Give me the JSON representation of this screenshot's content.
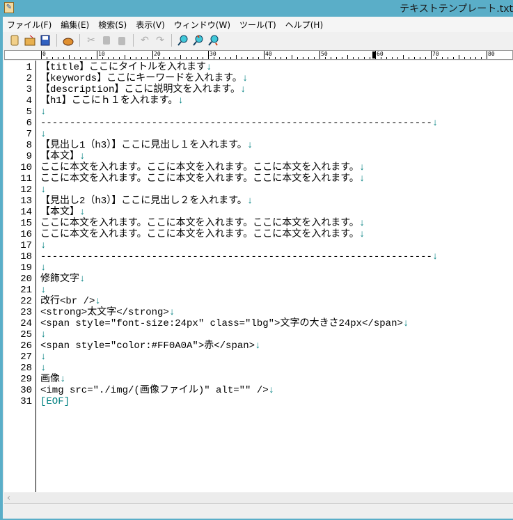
{
  "window": {
    "title": "テキストテンプレート.txt"
  },
  "menu": [
    "ファイル(F)",
    "編集(E)",
    "検索(S)",
    "表示(V)",
    "ウィンドウ(W)",
    "ツール(T)",
    "ヘルプ(H)"
  ],
  "toolbar": [
    "new-file",
    "open-folder",
    "save",
    "print",
    "cut",
    "copy",
    "paste",
    "undo",
    "redo",
    "search",
    "search-next",
    "search-prev"
  ],
  "ruler": [
    "0",
    "10",
    "20",
    "30",
    "40",
    "50",
    "60",
    "70",
    "80"
  ],
  "colors": {
    "eol": "#008080",
    "titlebar": "#5aaec8"
  },
  "lines": [
    {
      "n": "1",
      "t": "【title】ここにタイトルを入れます",
      "e": "↓"
    },
    {
      "n": "2",
      "t": "【keywords】ここにキーワードを入れます。",
      "e": "↓"
    },
    {
      "n": "3",
      "t": "【description】ここに説明文を入れます。",
      "e": "↓"
    },
    {
      "n": "4",
      "t": "【h1】ここにｈ１を入れます。",
      "e": "↓"
    },
    {
      "n": "5",
      "t": "",
      "e": "↓"
    },
    {
      "n": "6",
      "t": "-------------------------------------------------------------------",
      "e": "↓"
    },
    {
      "n": "7",
      "t": "",
      "e": "↓"
    },
    {
      "n": "8",
      "t": "【見出し1（h3）】ここに見出し１を入れます。",
      "e": "↓"
    },
    {
      "n": "9",
      "t": "【本文】",
      "e": "↓"
    },
    {
      "n": "10",
      "t": "ここに本文を入れます。ここに本文を入れます。ここに本文を入れます。",
      "e": "↓"
    },
    {
      "n": "11",
      "t": "ここに本文を入れます。ここに本文を入れます。ここに本文を入れます。",
      "e": "↓"
    },
    {
      "n": "12",
      "t": "",
      "e": "↓"
    },
    {
      "n": "13",
      "t": "【見出し2（h3）】ここに見出し２を入れます。",
      "e": "↓"
    },
    {
      "n": "14",
      "t": "【本文】",
      "e": "↓"
    },
    {
      "n": "15",
      "t": "ここに本文を入れます。ここに本文を入れます。ここに本文を入れます。",
      "e": "↓"
    },
    {
      "n": "16",
      "t": "ここに本文を入れます。ここに本文を入れます。ここに本文を入れます。",
      "e": "↓"
    },
    {
      "n": "17",
      "t": "",
      "e": "↓"
    },
    {
      "n": "18",
      "t": "-------------------------------------------------------------------",
      "e": "↓"
    },
    {
      "n": "19",
      "t": "",
      "e": "↓"
    },
    {
      "n": "20",
      "t": "修飾文字",
      "e": "↓"
    },
    {
      "n": "21",
      "t": "",
      "e": "↓"
    },
    {
      "n": "22",
      "t": "改行<br />",
      "e": "↓"
    },
    {
      "n": "23",
      "t": "<strong>太文字</strong>",
      "e": "↓"
    },
    {
      "n": "24",
      "t": "<span style=\"font-size:24px\" class=\"lbg\">文字の大きさ24px</span>",
      "e": "↓"
    },
    {
      "n": "25",
      "t": "",
      "e": "↓"
    },
    {
      "n": "26",
      "t": "<span style=\"color:#FF0A0A\">赤</span>",
      "e": "↓"
    },
    {
      "n": "27",
      "t": "",
      "e": "↓"
    },
    {
      "n": "28",
      "t": "",
      "e": "↓"
    },
    {
      "n": "29",
      "t": "画像",
      "e": "↓"
    },
    {
      "n": "30",
      "t": "<img src=\"./img/(画像ファイル)\" alt=\"\" />",
      "e": "↓"
    },
    {
      "n": "31",
      "t": "",
      "e": "",
      "eof": "[EOF]"
    }
  ]
}
